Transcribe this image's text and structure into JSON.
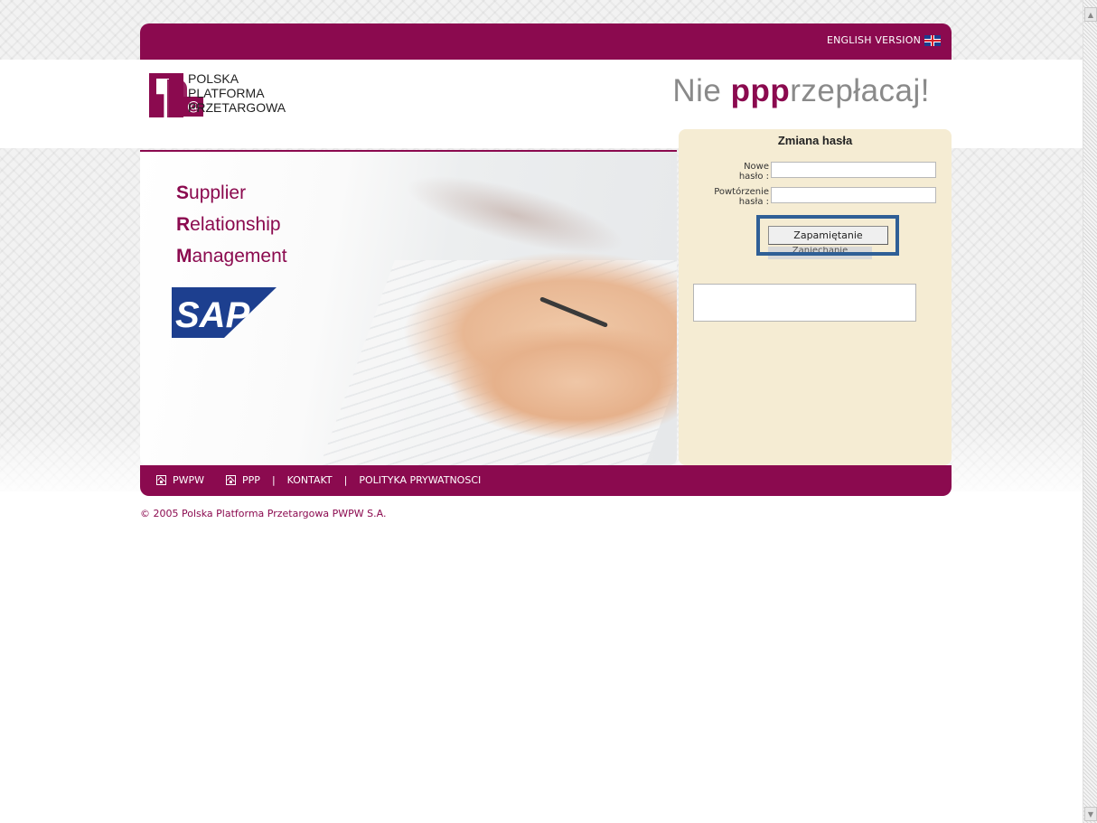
{
  "header": {
    "english_version_label": "ENGLISH VERSION",
    "logo_lines": [
      "POLSKA",
      "PLATFORMA",
      "PRZETARGOWA"
    ],
    "slogan_prefix": "Nie ",
    "slogan_bold": "ppp",
    "slogan_suffix": "rzepłacaj!"
  },
  "hero": {
    "srm_lines": [
      {
        "initial": "S",
        "rest": "upplier"
      },
      {
        "initial": "R",
        "rest": "elationship"
      },
      {
        "initial": "M",
        "rest": "anagement"
      }
    ],
    "sap_text": "SAP"
  },
  "password_form": {
    "title": "Zmiana hasła",
    "new_password_label_line1": "Nowe",
    "new_password_label_line2": "hasło :",
    "new_password_value": "",
    "repeat_password_label_line1": "Powtórzenie",
    "repeat_password_label_line2": "hasła :",
    "repeat_password_value": "",
    "save_button_label": "Zapamiętanie",
    "cancel_button_label": "Zaniechanie",
    "message_text": ""
  },
  "footer": {
    "nav": [
      "PWPW",
      "PPP",
      "KONTAKT",
      "POLITYKA PRYWATNOSCI"
    ],
    "separator": "|",
    "copyright": "© 2005 Polska Platforma Przetargowa PWPW S.A."
  },
  "colors": {
    "brand": "#8b0a4f",
    "panel_bg": "#f5ecd3",
    "highlight_border": "#2f5f96",
    "sap_blue": "#1d3f8f"
  }
}
